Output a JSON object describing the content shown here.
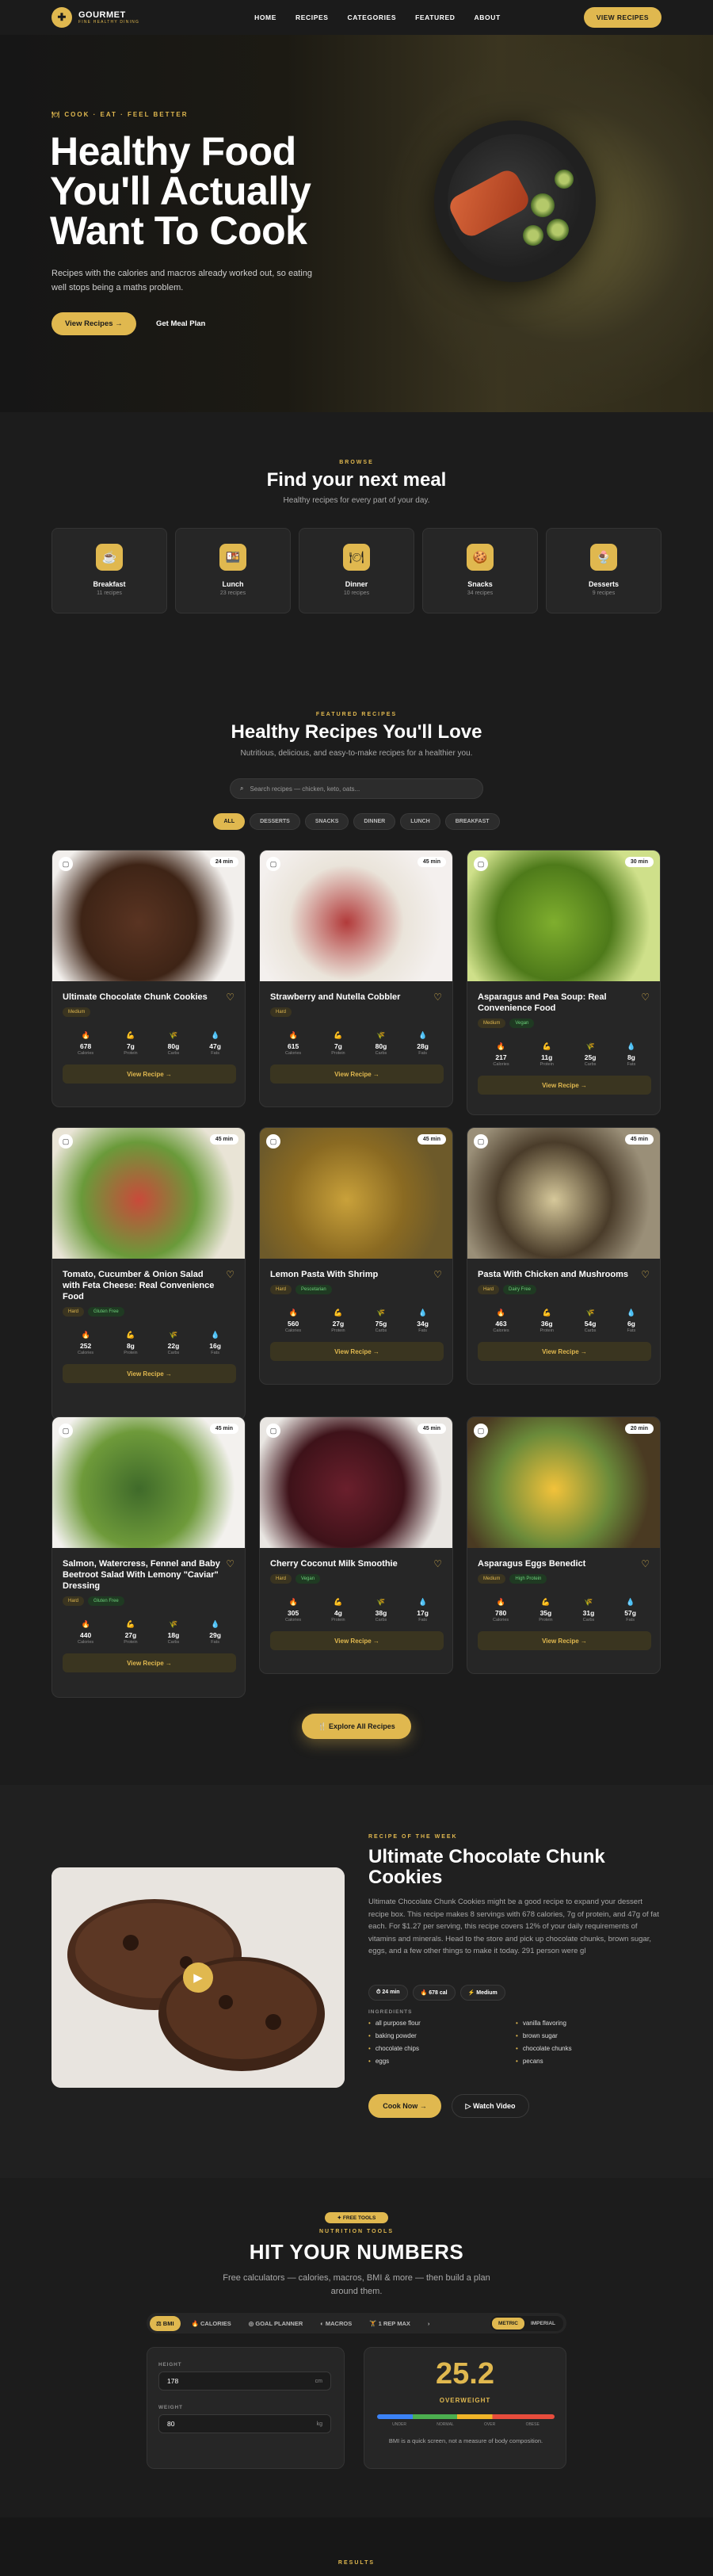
{
  "nav": {
    "brand": "GOURMET",
    "tagline": "FINE HEALTHY DINING",
    "links": [
      "HOME",
      "RECIPES",
      "CATEGORIES",
      "FEATURED",
      "ABOUT"
    ],
    "cta": "VIEW RECIPES"
  },
  "hero": {
    "eyebrow": "🍽 COOK · EAT · FEEL BETTER",
    "title": "Healthy Food You'll Actually Want To Cook",
    "subtitle": "Recipes with the calories and macros already worked out, so eating well stops being a maths problem.",
    "primary_btn": "View Recipes →",
    "secondary_btn": "Get Meal Plan"
  },
  "browse": {
    "eyebrow": "BROWSE",
    "title": "Find your next meal",
    "subtitle": "Healthy recipes for every part of your day.",
    "categories": [
      {
        "name": "Breakfast",
        "count": "11 recipes",
        "icon": "☕"
      },
      {
        "name": "Lunch",
        "count": "23 recipes",
        "icon": "🍱"
      },
      {
        "name": "Dinner",
        "count": "10 recipes",
        "icon": "🍽"
      },
      {
        "name": "Snacks",
        "count": "34 recipes",
        "icon": "🍪"
      },
      {
        "name": "Desserts",
        "count": "9 recipes",
        "icon": "🍨"
      }
    ]
  },
  "featured_list": {
    "eyebrow": "FEATURED RECIPES",
    "title": "Healthy Recipes You'll Love",
    "subtitle": "Nutritious, delicious, and easy-to-make recipes for a healthier you.",
    "search_placeholder": "Search recipes — chicken, keto, oats...",
    "filters": [
      "ALL",
      "DESSERTS",
      "SNACKS",
      "DINNER",
      "LUNCH",
      "BREAKFAST"
    ],
    "labels": {
      "calories": "Calories",
      "protein": "Protein",
      "carbs": "Carbs",
      "fats": "Fats",
      "view": "View Recipe →"
    },
    "recipes": [
      {
        "title": "Ultimate Chocolate Chunk Cookies",
        "time": "24 min",
        "tags": [
          "Medium"
        ],
        "cal": "678",
        "protein": "7g",
        "carbs": "80g",
        "fats": "47g"
      },
      {
        "title": "Strawberry and Nutella Cobbler",
        "time": "45 min",
        "tags": [
          "Hard"
        ],
        "cal": "615",
        "protein": "7g",
        "carbs": "80g",
        "fats": "28g"
      },
      {
        "title": "Asparagus and Pea Soup: Real Convenience Food",
        "time": "30 min",
        "tags": [
          "Medium",
          "Vegan"
        ],
        "cal": "217",
        "protein": "11g",
        "carbs": "25g",
        "fats": "8g"
      },
      {
        "title": "Tomato, Cucumber & Onion Salad with Feta Cheese: Real Convenience Food",
        "time": "45 min",
        "tags": [
          "Hard",
          "Gluten Free"
        ],
        "cal": "252",
        "protein": "8g",
        "carbs": "22g",
        "fats": "16g"
      },
      {
        "title": "Lemon Pasta With Shrimp",
        "time": "45 min",
        "tags": [
          "Hard",
          "Pescetarian"
        ],
        "cal": "560",
        "protein": "27g",
        "carbs": "75g",
        "fats": "34g"
      },
      {
        "title": "Pasta With Chicken and Mushrooms",
        "time": "45 min",
        "tags": [
          "Hard",
          "Dairy Free"
        ],
        "cal": "463",
        "protein": "36g",
        "carbs": "54g",
        "fats": "6g"
      },
      {
        "title": "Salmon, Watercress, Fennel and Baby Beetroot Salad With Lemony \"Caviar\" Dressing",
        "time": "45 min",
        "tags": [
          "Hard",
          "Gluten Free"
        ],
        "cal": "440",
        "protein": "27g",
        "carbs": "18g",
        "fats": "29g"
      },
      {
        "title": "Cherry Coconut Milk Smoothie",
        "time": "45 min",
        "tags": [
          "Hard",
          "Vegan"
        ],
        "cal": "305",
        "protein": "4g",
        "carbs": "38g",
        "fats": "17g"
      },
      {
        "title": "Asparagus Eggs Benedict",
        "time": "20 min",
        "tags": [
          "Medium",
          "High Protein"
        ],
        "cal": "780",
        "protein": "35g",
        "carbs": "31g",
        "fats": "57g"
      }
    ],
    "explore_btn": "🍴 Explore All Recipes"
  },
  "recipe_of_week": {
    "eyebrow": "RECIPE OF THE WEEK",
    "title": "Ultimate Chocolate Chunk Cookies",
    "description": "Ultimate Chocolate Chunk Cookies might be a good recipe to expand your dessert recipe box. This recipe makes 8 servings with 678 calories, 7g of protein, and 47g of fat each. For $1.27 per serving, this recipe covers 12% of your daily requirements of vitamins and minerals. Head to the store and pick up chocolate chunks, brown sugar, eggs, and a few other things to make it today. 291 person were gl",
    "meta": [
      "⏱ 24 min",
      "🔥 678 cal",
      "⚡ Medium"
    ],
    "ingredients_label": "INGREDIENTS",
    "ingredients": [
      "all purpose flour",
      "vanilla flavoring",
      "baking powder",
      "brown sugar",
      "chocolate chips",
      "chocolate chunks",
      "eggs",
      "pecans"
    ],
    "cook_btn": "Cook Now →",
    "watch_btn": "▷ Watch Video"
  },
  "tools": {
    "badge": "✦ FREE TOOLS",
    "eyebrow": "NUTRITION TOOLS",
    "title": "HIT YOUR NUMBERS",
    "subtitle": "Free calculators — calories, macros, BMI & more — then build a plan around them.",
    "tabs": [
      "⚖ BMI",
      "🔥 CALORIES",
      "◎ GOAL PLANNER",
      "◐ MACROS",
      "🏋 1 REP MAX",
      "›"
    ],
    "units": [
      "METRIC",
      "IMPERIAL"
    ],
    "height_label": "HEIGHT",
    "height_value": "178",
    "height_unit": "cm",
    "weight_label": "WEIGHT",
    "weight_value": "80",
    "weight_unit": "kg",
    "bmi_value": "25.2",
    "bmi_status": "OVERWEIGHT",
    "scale_labels": [
      "UNDER",
      "NORMAL",
      "OVER",
      "OBESE"
    ],
    "bmi_note": "BMI is a quick screen, not a measure of body composition."
  },
  "results_eyebrow": "RESULTS",
  "colors": {
    "accent": "#e0b84f",
    "background": "#1c1c1c",
    "card": "#262626",
    "green_tag": "#6ccf7a"
  }
}
